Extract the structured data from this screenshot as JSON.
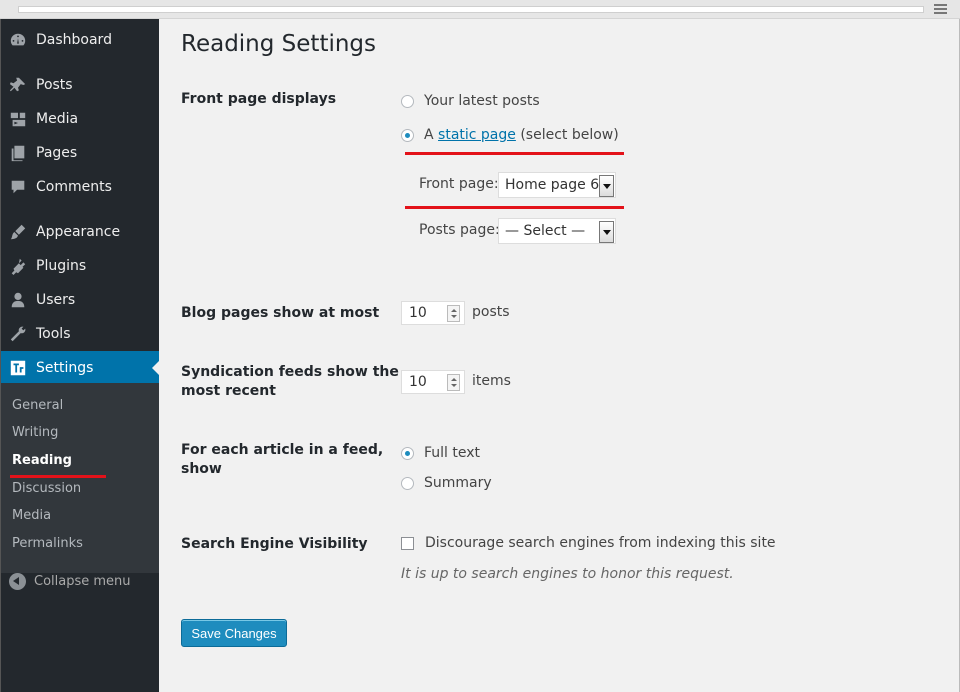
{
  "sidebar": {
    "items": [
      {
        "label": "Dashboard",
        "icon": "dashboard-icon"
      },
      {
        "label": "Posts",
        "icon": "pin-icon"
      },
      {
        "label": "Media",
        "icon": "media-icon"
      },
      {
        "label": "Pages",
        "icon": "pages-icon"
      },
      {
        "label": "Comments",
        "icon": "comment-icon"
      },
      {
        "label": "Appearance",
        "icon": "brush-icon"
      },
      {
        "label": "Plugins",
        "icon": "plug-icon"
      },
      {
        "label": "Users",
        "icon": "user-icon"
      },
      {
        "label": "Tools",
        "icon": "wrench-icon"
      },
      {
        "label": "Settings",
        "icon": "settings-icon"
      }
    ],
    "submenu": [
      "General",
      "Writing",
      "Reading",
      "Discussion",
      "Media",
      "Permalinks"
    ],
    "collapse_label": "Collapse menu"
  },
  "page": {
    "title": "Reading Settings",
    "front_page_displays": {
      "label": "Front page displays",
      "option_latest": "Your latest posts",
      "option_static_prefix": "A",
      "option_static_link": "static page",
      "option_static_suffix": "(select below)",
      "front_page_label": "Front page:",
      "front_page_value": "Home page 6",
      "posts_page_label": "Posts page:",
      "posts_page_value": "— Select —"
    },
    "blog_pages": {
      "label": "Blog pages show at most",
      "value": "10",
      "unit": "posts"
    },
    "syndication": {
      "label_line1": "Syndication feeds show the",
      "label_line2": "most recent",
      "value": "10",
      "unit": "items"
    },
    "feed_article": {
      "label_line1": "For each article in a feed,",
      "label_line2": "show",
      "option_full": "Full text",
      "option_summary": "Summary"
    },
    "search_visibility": {
      "label": "Search Engine Visibility",
      "checkbox_label": "Discourage search engines from indexing this site",
      "description": "It is up to search engines to honor this request."
    },
    "save_label": "Save Changes"
  },
  "colors": {
    "sidebar_bg": "#23282d",
    "active": "#0073aa",
    "highlight": "#e3121a",
    "button": "#1e8cbe"
  }
}
